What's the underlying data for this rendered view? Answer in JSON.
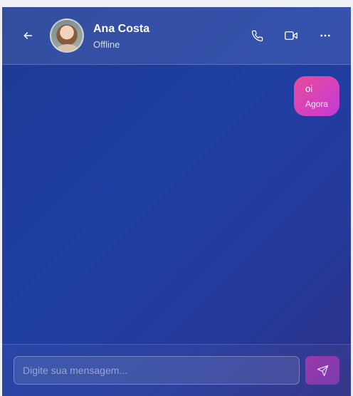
{
  "header": {
    "contact_name": "Ana Costa",
    "contact_status": "Offline",
    "icons": [
      "arrow-left-icon",
      "phone-icon",
      "video-icon",
      "more-horizontal-icon"
    ]
  },
  "messages": [
    {
      "text": "oi",
      "time": "Agora",
      "sender": "me"
    }
  ],
  "composer": {
    "placeholder": "Digite sua mensagem...",
    "value": "",
    "send_icon": "send-icon"
  },
  "colors": {
    "background_start": "#1d3a94",
    "background_end": "#2d2f86",
    "bubble_start": "#e84c9a",
    "bubble_end": "#c43ad6",
    "send_button": "#9a3aa8"
  }
}
